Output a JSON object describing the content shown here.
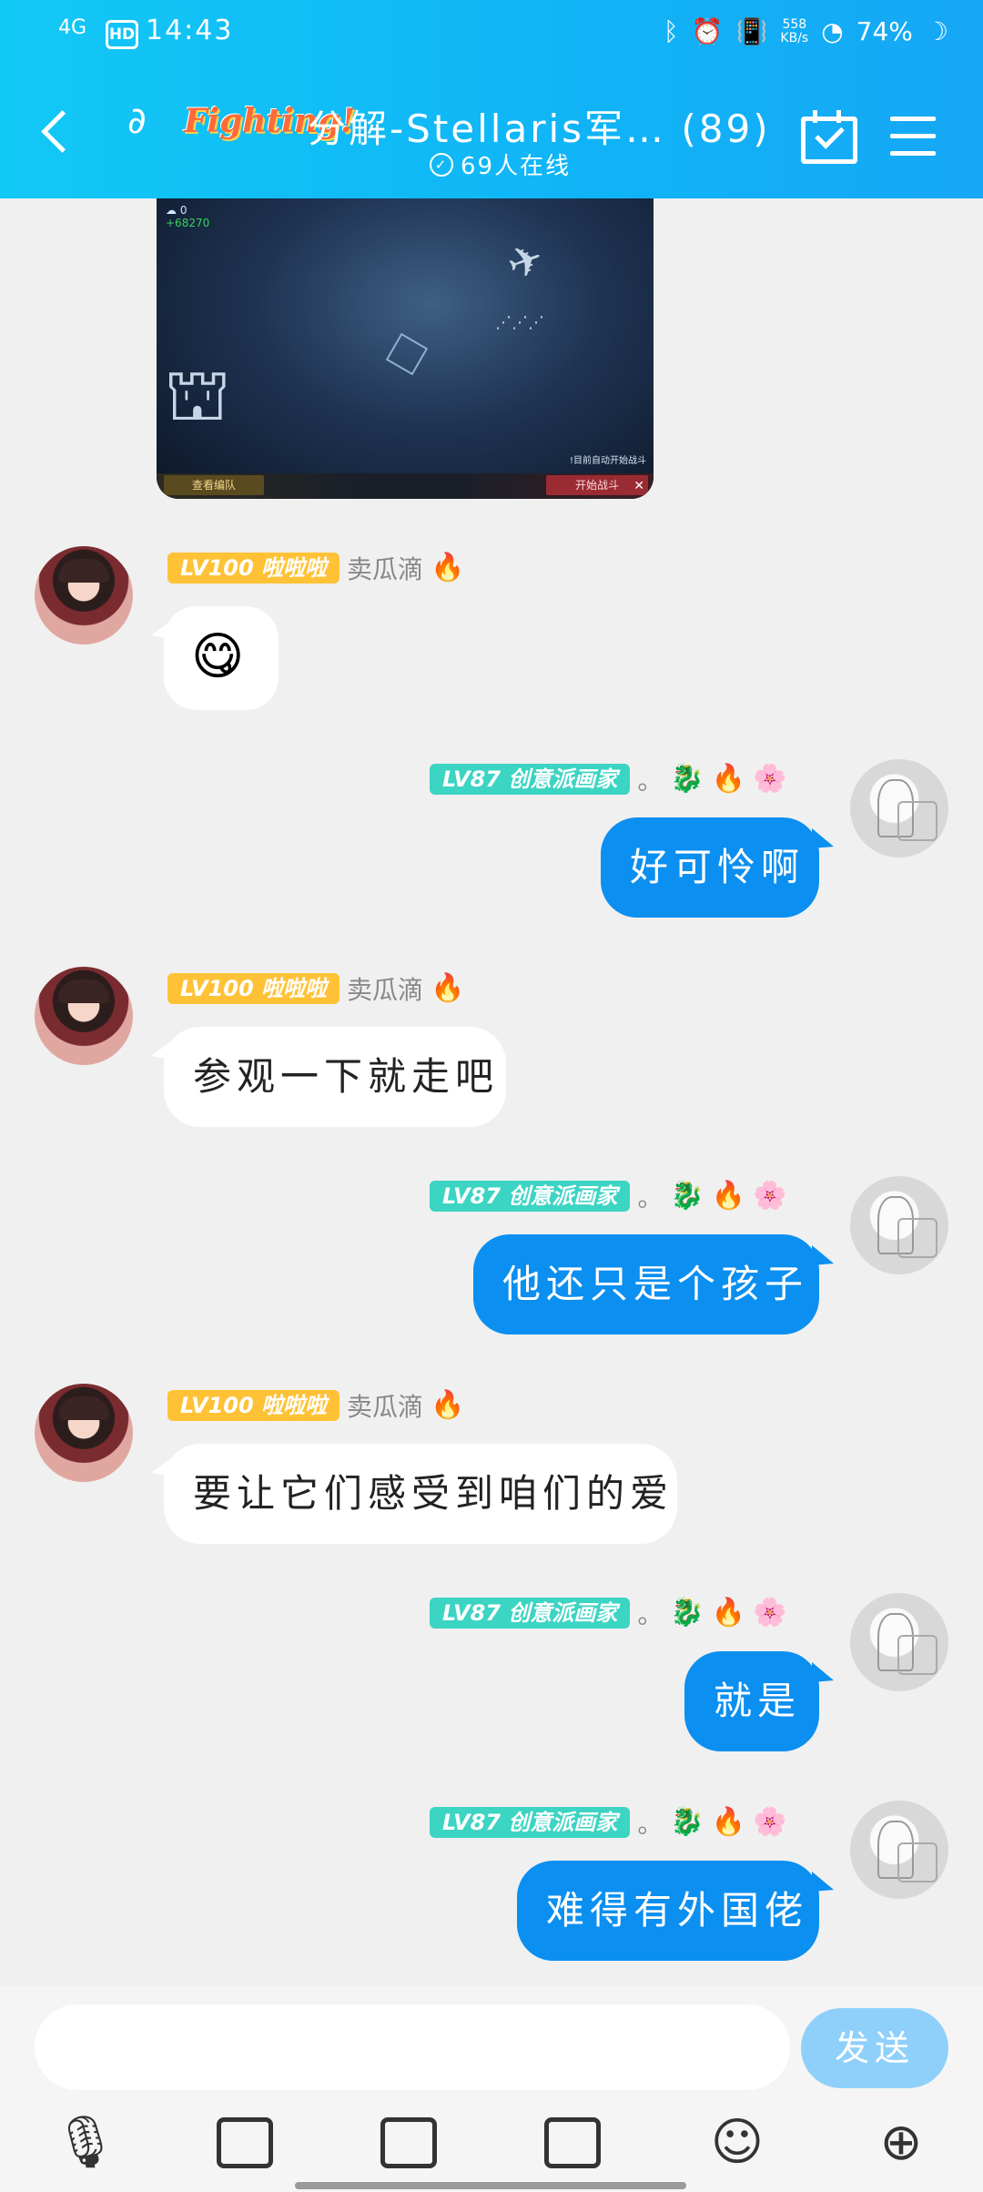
{
  "status_bar": {
    "network": "4G",
    "hd": "HD",
    "time": "14:43",
    "bluetooth_icon": "bluetooth-icon",
    "alarm_icon": "alarm-icon",
    "vibrate_icon": "vibrate-icon",
    "speed": "558",
    "speed_unit": "KB/s",
    "wifi_icon": "wifi-icon",
    "battery": "74%"
  },
  "header": {
    "logo_text": "Fighting!",
    "title": "分解-Stellaris军… (89)",
    "online": "69人在线"
  },
  "screenshot_message": {
    "hud_count": "0",
    "hud_value": "+68270",
    "left_button": "查看编队",
    "right_button": "开始战斗",
    "tip": "!目前自动开始战斗",
    "close": "✕"
  },
  "users": {
    "left": {
      "level": "LV100",
      "title": "啦啦啦",
      "nick": "卖瓜滴",
      "icon": "🔥"
    },
    "right": {
      "level": "LV87",
      "title": "创意派画家",
      "nick": "。",
      "icons": [
        "🐉",
        "🔥",
        "🌸"
      ]
    }
  },
  "messages": [
    {
      "side": "left",
      "text": "😋"
    },
    {
      "side": "right",
      "text": "好可怜啊"
    },
    {
      "side": "left",
      "text": "参观一下就走吧"
    },
    {
      "side": "right",
      "text": "他还只是个孩子"
    },
    {
      "side": "left",
      "text": "要让它们感受到咱们的爱"
    },
    {
      "side": "right",
      "text": "就是"
    },
    {
      "side": "right",
      "text": "难得有外国佬"
    }
  ],
  "input": {
    "placeholder": "",
    "send_label": "发送"
  },
  "toolbar": [
    "mic-icon",
    "image-icon",
    "camera-icon",
    "bag-icon",
    "emoji-icon",
    "plus-icon"
  ],
  "colors": {
    "header": "#12c8f5",
    "bubble_right": "#0b8ff0",
    "badge_yellow": "#ffc236",
    "badge_teal": "#3cd4c2"
  }
}
